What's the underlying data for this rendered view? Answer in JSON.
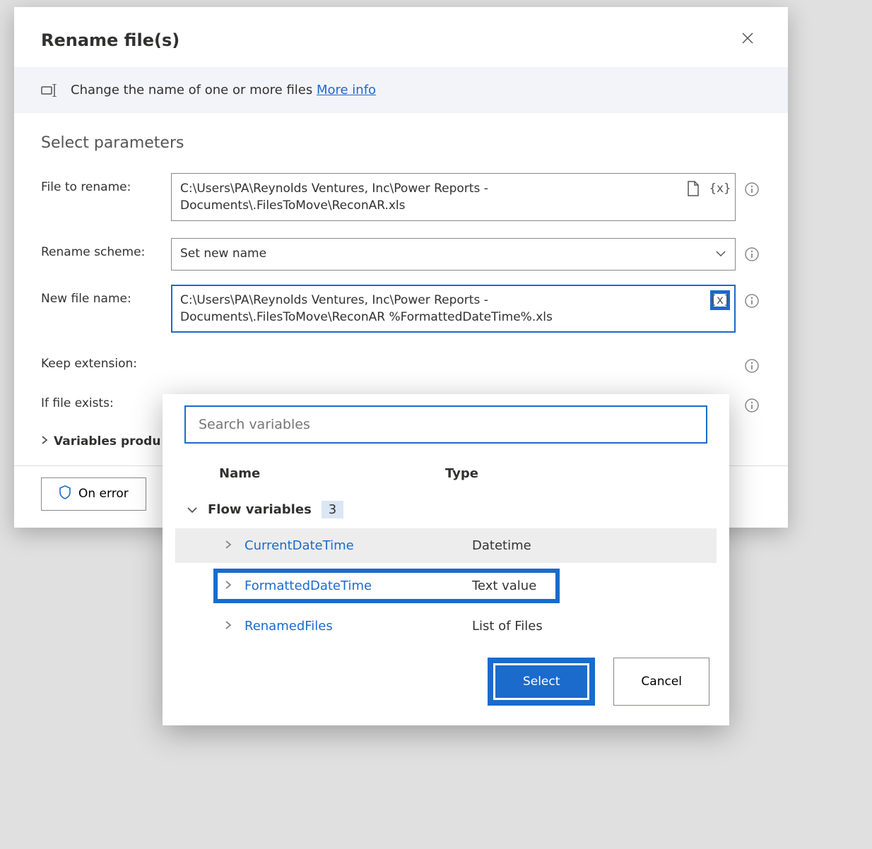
{
  "dialog": {
    "title": "Rename file(s)",
    "banner_text": "Change the name of one or more files ",
    "more_info": "More info",
    "section_title": "Select parameters",
    "labels": {
      "file_to_rename": "File to rename:",
      "rename_scheme": "Rename scheme:",
      "new_file_name": "New file name:",
      "keep_extension": "Keep extension:",
      "if_file_exists": "If file exists:",
      "variables_produced": "Variables produ"
    },
    "values": {
      "file_to_rename": "C:\\Users\\PA\\Reynolds Ventures, Inc\\Power Reports - Documents\\.FilesToMove\\ReconAR.xls",
      "rename_scheme": "Set new name",
      "new_file_name": "C:\\Users\\PA\\Reynolds Ventures, Inc\\Power Reports - Documents\\.FilesToMove\\ReconAR %FormattedDateTime%.xls"
    },
    "on_error": "On error"
  },
  "var_picker": {
    "search_placeholder": "Search variables",
    "col_name": "Name",
    "col_type": "Type",
    "group_label": "Flow variables",
    "group_count": "3",
    "items": [
      {
        "name": "CurrentDateTime",
        "type": "Datetime"
      },
      {
        "name": "FormattedDateTime",
        "type": "Text value"
      },
      {
        "name": "RenamedFiles",
        "type": "List of Files"
      }
    ],
    "select_label": "Select",
    "cancel_label": "Cancel"
  }
}
